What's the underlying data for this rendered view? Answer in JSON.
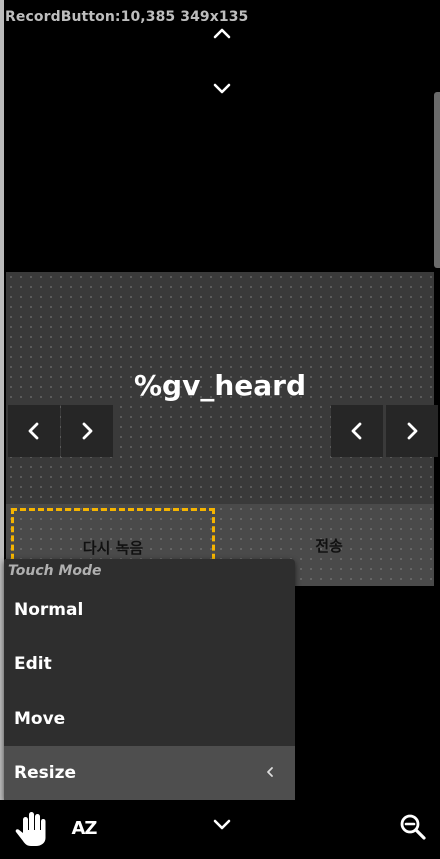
{
  "debug_label": "RecordButton:10,385 349x135",
  "panel": {
    "variable_text": "%gv_heard"
  },
  "buttons": {
    "rerecord_label": "다시 녹음",
    "send_label": "전송"
  },
  "touch_menu": {
    "title": "Touch Mode",
    "items": [
      {
        "label": "Normal"
      },
      {
        "label": "Edit"
      },
      {
        "label": "Move"
      },
      {
        "label": "Resize"
      }
    ],
    "selected": "Resize"
  },
  "bottom_toolbar": {
    "sort_label": "AZ"
  },
  "icons": [
    "chevron-up-icon",
    "chevron-down-icon",
    "chevron-left-icon",
    "chevron-right-icon",
    "hand-icon",
    "sort-az-icon",
    "zoom-out-icon"
  ]
}
